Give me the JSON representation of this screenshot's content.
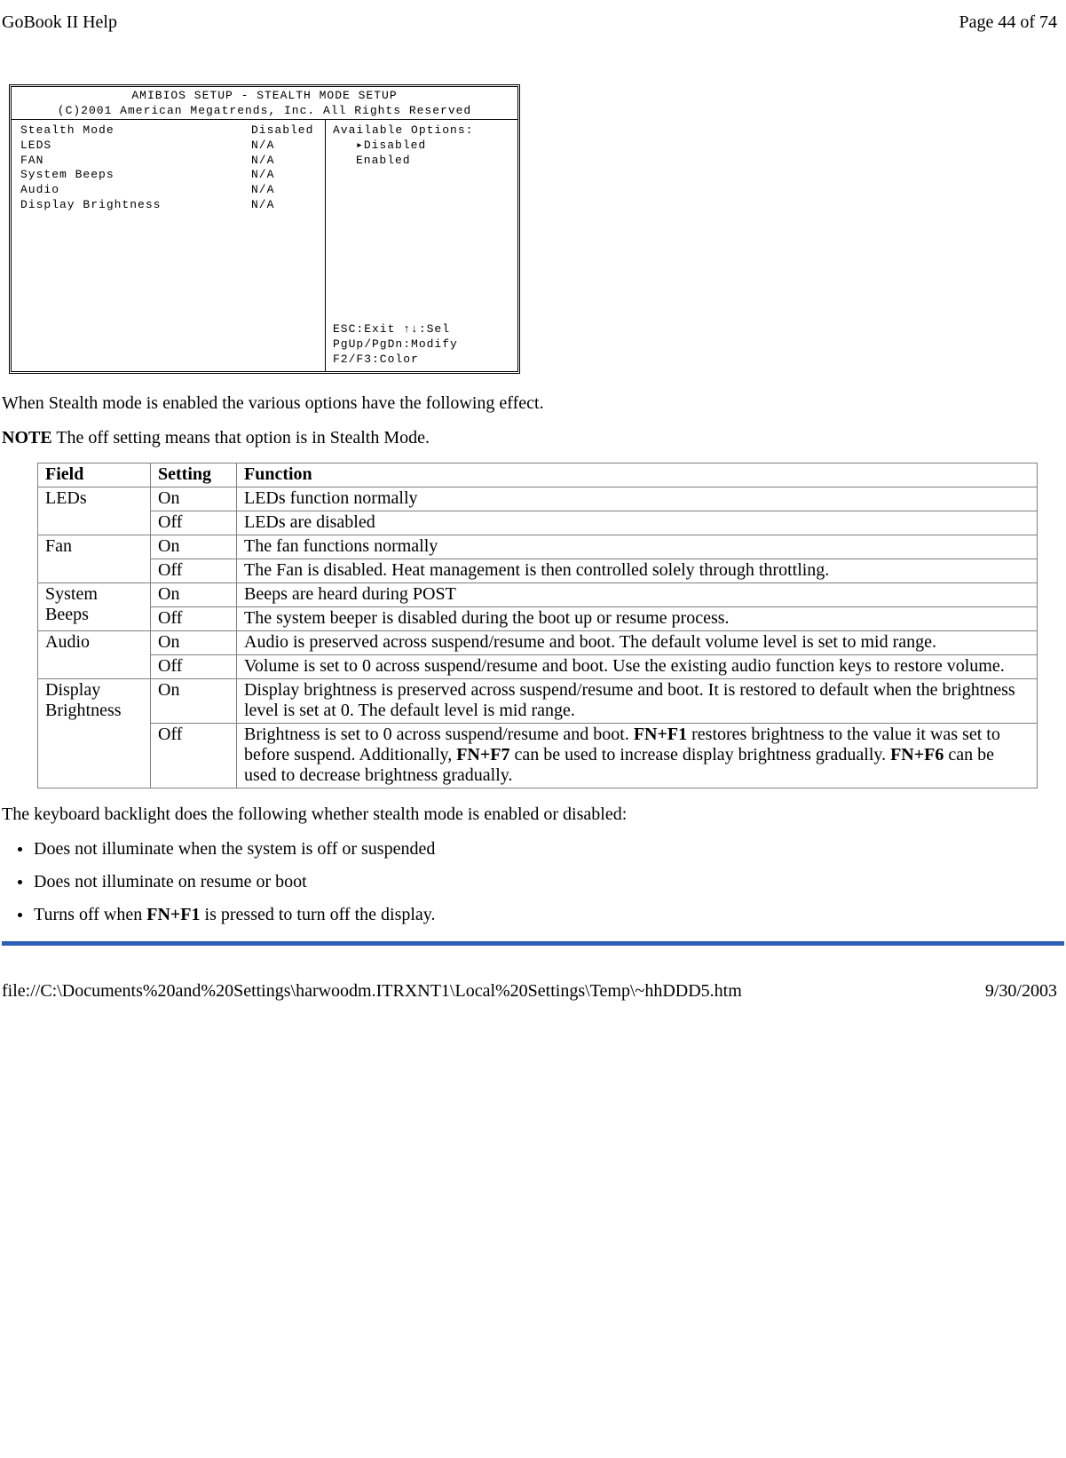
{
  "header": {
    "left": "GoBook II Help",
    "right": "Page 44 of 74"
  },
  "footer": {
    "left": "file://C:\\Documents%20and%20Settings\\harwoodm.ITRXNT1\\Local%20Settings\\Temp\\~hhDDD5.htm",
    "right": "9/30/2003"
  },
  "bios": {
    "title1": "AMIBIOS SETUP - STEALTH MODE SETUP",
    "title2": "(C)2001 American Megatrends, Inc. All Rights Reserved",
    "rows": [
      {
        "label": "Stealth Mode",
        "value": "Disabled"
      },
      {
        "label": "LEDS",
        "value": "N/A"
      },
      {
        "label": "FAN",
        "value": "N/A"
      },
      {
        "label": "System Beeps",
        "value": "N/A"
      },
      {
        "label": "Audio",
        "value": "N/A"
      },
      {
        "label": "Display Brightness",
        "value": "N/A"
      }
    ],
    "right_title": "Available Options:",
    "options": [
      "▸Disabled",
      " Enabled"
    ],
    "help": [
      "ESC:Exit ↑↓:Sel",
      "PgUp/PgDn:Modify",
      "F2/F3:Color"
    ]
  },
  "body": {
    "p1": "When Stealth mode is enabled the various options have the following effect.",
    "note_label": "NOTE",
    "note_text": "  The off setting means that option is in Stealth Mode.",
    "p3": "The keyboard backlight does the following whether stealth mode is enabled or disabled:",
    "bullets": {
      "b1": "Does not illuminate when the system is off or suspended",
      "b2": "Does not illuminate on resume or boot",
      "b3_pre": "Turns off when ",
      "b3_bold": "FN+F1",
      "b3_post": " is pressed to turn off the display."
    }
  },
  "table": {
    "h1": "Field",
    "h2": "Setting",
    "h3": "Function",
    "r1f": "LEDs",
    "r1s": "On",
    "r1d": "LEDs function normally",
    "r2s": "Off",
    "r2d": "LEDs are disabled",
    "r3f": "Fan",
    "r3s": "On",
    "r3d": "The fan functions normally",
    "r4s": "Off",
    "r4d": "The Fan is disabled.  Heat management is then controlled solely through throttling.",
    "r5f": "System Beeps",
    "r5s": "On",
    "r5d": "Beeps are heard during POST",
    "r6s": "Off",
    "r6d": "The system beeper is disabled during the boot up or resume process.",
    "r7f": "Audio",
    "r7s": "On",
    "r7d": "Audio is preserved across suspend/resume and boot.  The default volume level is set to mid range.",
    "r8s": "Off",
    "r8d": "Volume is set to 0 across suspend/resume and boot.  Use the existing audio function keys to restore volume.",
    "r9f": "Display Brightness",
    "r9s": "On",
    "r9d": "Display brightness is preserved across suspend/resume and boot.  It is restored to default when the brightness level is set at 0.  The default level is mid range.",
    "r10s": "Off",
    "r10d_1": "Brightness is set to 0 across suspend/resume and boot.  ",
    "r10d_b1": "FN+F1",
    "r10d_2": " restores brightness to the value it was set to before suspend.  Additionally, ",
    "r10d_b2": "FN+F7",
    "r10d_3": " can be used to increase display brightness gradually.  ",
    "r10d_b3": "FN+F6",
    "r10d_4": " can be used to decrease brightness gradually."
  }
}
